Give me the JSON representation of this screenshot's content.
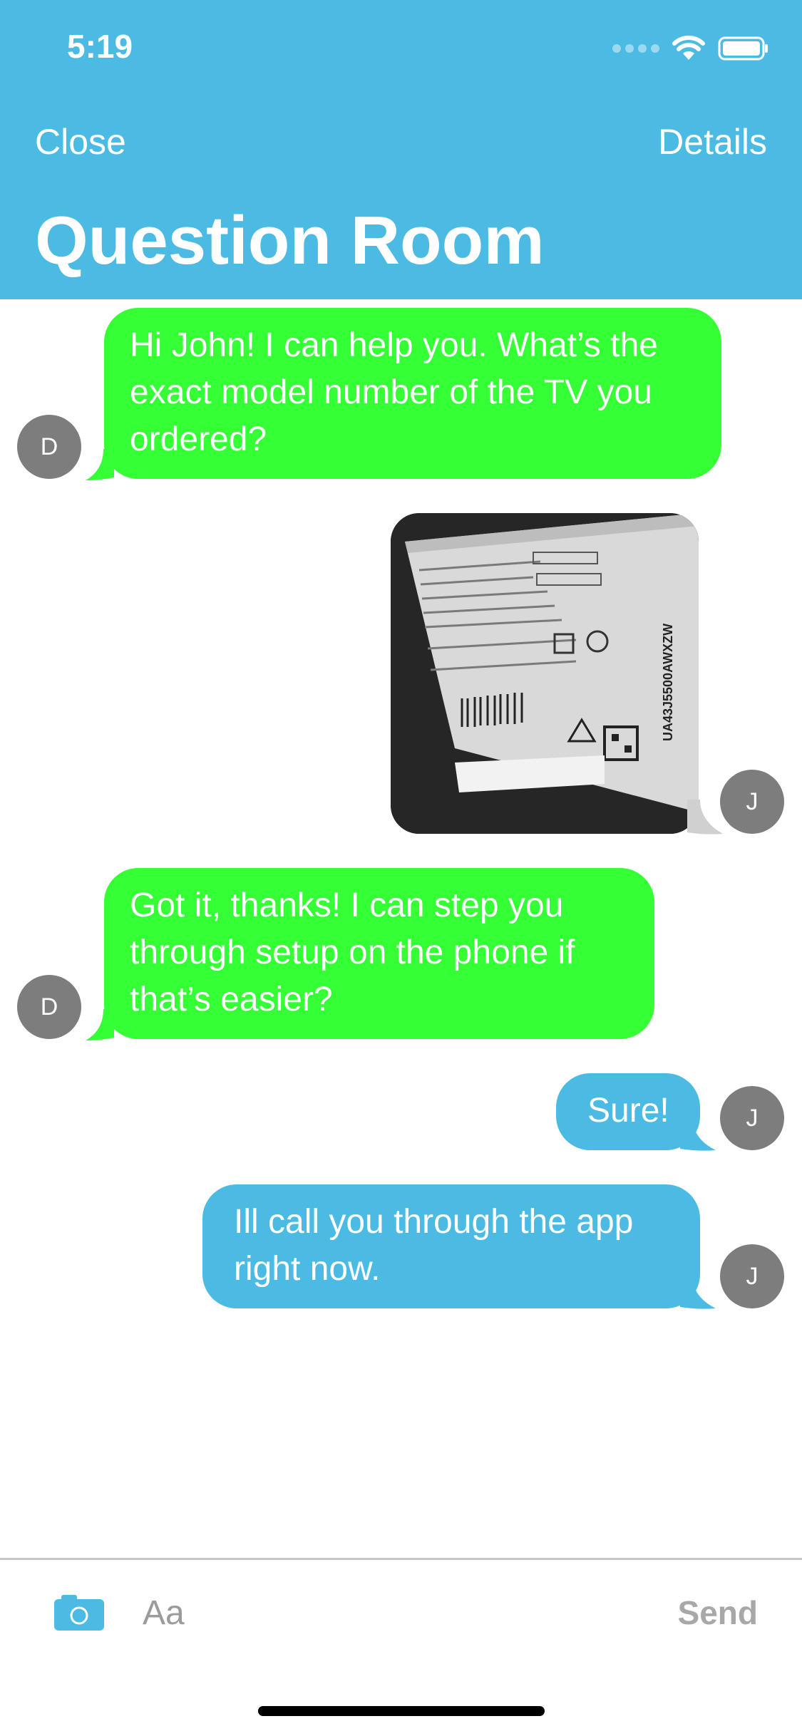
{
  "status_bar": {
    "time": "5:19"
  },
  "nav": {
    "close_label": "Close",
    "details_label": "Details",
    "title": "Question Room"
  },
  "messages": [
    {
      "sender": "D",
      "text": "Hi John! I can help you. What’s the exact model number of the TV you ordered?"
    },
    {
      "sender": "J",
      "type": "image",
      "image_label_text": "UA43J5500AWXZW"
    },
    {
      "sender": "D",
      "text": "Got it, thanks! I can step you through setup on the phone if that’s easier?"
    },
    {
      "sender": "J",
      "text": "Sure!"
    },
    {
      "sender": "J",
      "text": "Ill call you through the app right now."
    }
  ],
  "composer": {
    "placeholder": "Aa",
    "send_label": "Send"
  },
  "colors": {
    "header": "#4bbbe3",
    "incoming_bubble": "#35ff35",
    "outgoing_bubble": "#4bbbe3",
    "avatar": "#7d7d7d"
  },
  "icons": [
    "signal-icon",
    "wifi-icon",
    "battery-icon",
    "camera-icon"
  ]
}
